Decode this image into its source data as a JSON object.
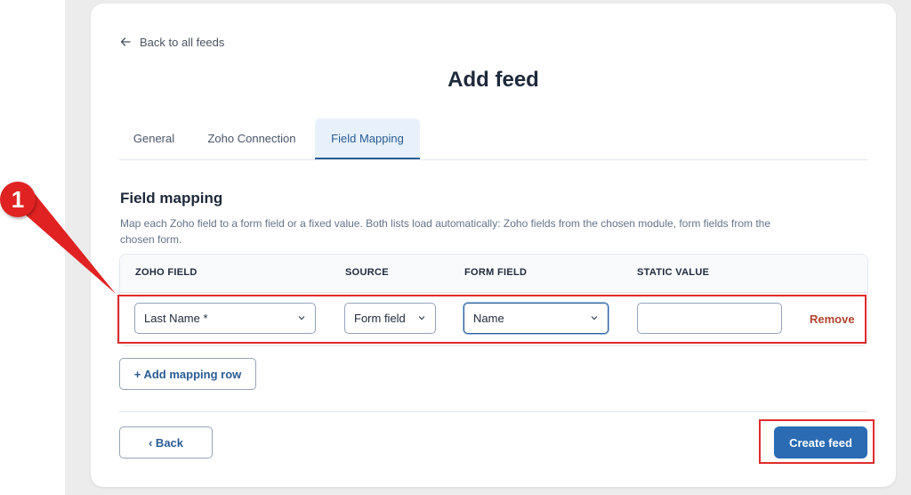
{
  "back_link": {
    "label": "Back to all feeds",
    "icon": "arrow-left-icon"
  },
  "page_title": "Add feed",
  "tabs": [
    {
      "label": "General",
      "active": false
    },
    {
      "label": "Zoho Connection",
      "active": false
    },
    {
      "label": "Field Mapping",
      "active": true
    }
  ],
  "section": {
    "title": "Field mapping",
    "description": "Map each Zoho field to a form field or a fixed value. Both lists load automatically: Zoho fields from the chosen module, form fields from the chosen form."
  },
  "table": {
    "headers": [
      "ZOHO FIELD",
      "SOURCE",
      "FORM FIELD",
      "STATIC VALUE"
    ],
    "row": {
      "zoho_field": "Last Name *",
      "source": "Form field",
      "form_field": "Name",
      "static_value": "",
      "remove_label": "Remove"
    }
  },
  "add_row_label": "+ Add mapping row",
  "back_button_label": "‹ Back",
  "create_button_label": "Create feed",
  "annotation": {
    "number": "1",
    "color": "#e02222"
  },
  "colors": {
    "accent": "#2a6bb3",
    "danger": "#b0452e",
    "highlight": "#e02b2b"
  }
}
